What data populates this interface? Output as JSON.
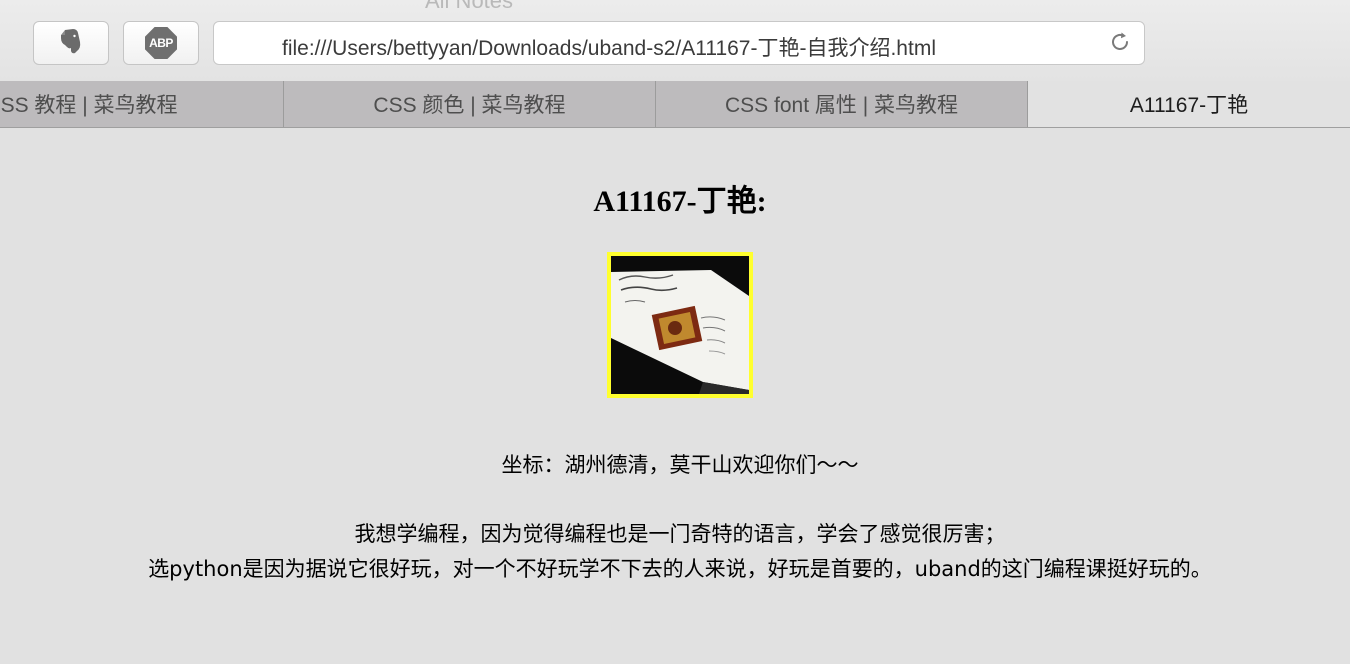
{
  "window": {
    "ghost_title": "All Notes"
  },
  "toolbar": {
    "evernote_icon": "evernote-elephant-icon",
    "abp_label": "ABP",
    "url": "file:///Users/bettyyan/Downloads/uband-s2/A11167-丁艳-自我介绍.html",
    "reload_icon": "reload-icon"
  },
  "tabs": [
    {
      "label": "CSS 教程 | 菜鸟教程",
      "active": false
    },
    {
      "label": "CSS 颜色 | 菜鸟教程",
      "active": false
    },
    {
      "label": "CSS font 属性 | 菜鸟教程",
      "active": false
    },
    {
      "label": "A11167-丁艳",
      "active": true
    }
  ],
  "page": {
    "heading": "A11167-丁艳:",
    "photo_border_color": "#ffff2e",
    "location_text": "坐标：湖州德清，莫干山欢迎你们～～",
    "reason_line_1": "我想学编程，因为觉得编程也是一门奇特的语言，学会了感觉很厉害；",
    "reason_line_2": "选python是因为据说它很好玩，对一个不好玩学不下去的人来说，好玩是首要的，uband的这门编程课挺好玩的。"
  },
  "colors": {
    "page_background": "#e1e1e1",
    "tabbar_background": "#bdbbbd",
    "active_tab_background": "#e2e2e2"
  }
}
